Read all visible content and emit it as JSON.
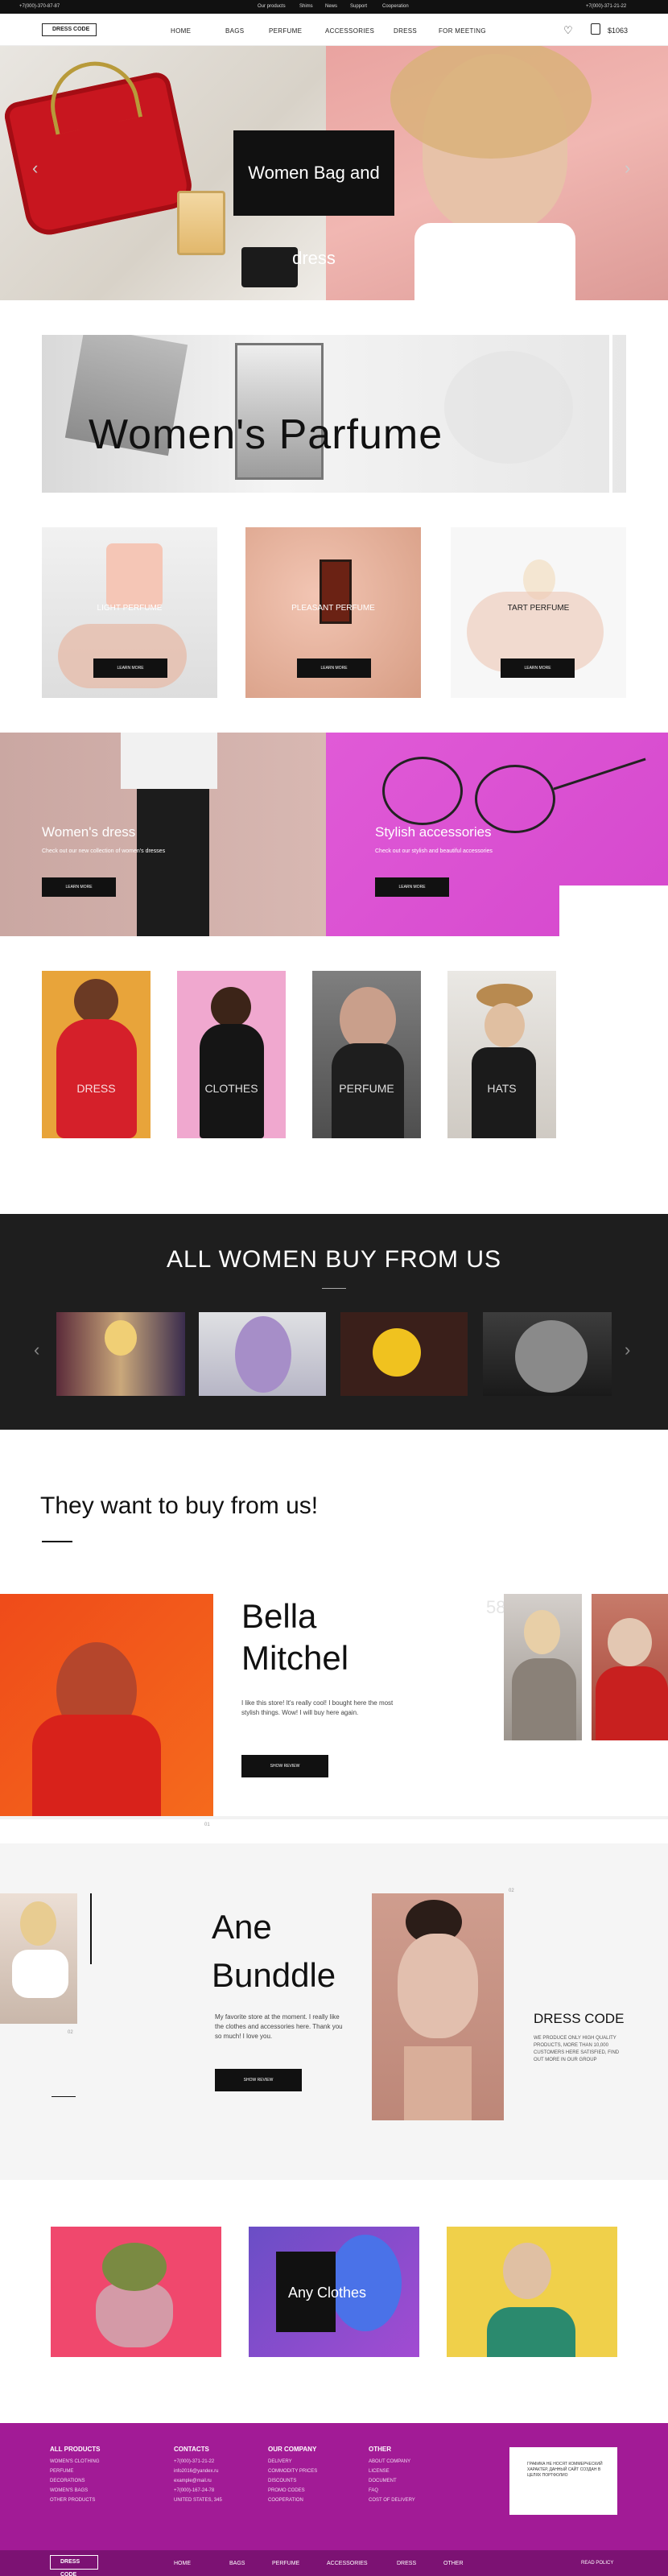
{
  "topbar": {
    "phone_left": "+7(000)-370-87-87",
    "links": [
      "Our products",
      "Shims",
      "News",
      "Support",
      "Cooperation"
    ],
    "phone_right": "+7(000)-371-21-22"
  },
  "header": {
    "logo": "DRESS CODE",
    "nav": [
      "HOME",
      "BAGS",
      "PERFUME",
      "ACCESSORIES",
      "DRESS",
      "FOR MEETING"
    ],
    "cart_total": "$1063"
  },
  "hero": {
    "caption": "Women Bag and dress",
    "prev_icon": "chevron-left-icon",
    "next_icon": "chevron-right-icon"
  },
  "parfume_banner": {
    "title": "Women's Parfume"
  },
  "perfume_cards": [
    {
      "label": "LIGHT PERFUME",
      "button": "LEARN MORE"
    },
    {
      "label": "PLEASANT PERFUME",
      "button": "LEARN MORE"
    },
    {
      "label": "TART PERFUME",
      "button": "LEARN MORE"
    }
  ],
  "promo": [
    {
      "title": "Women's dress",
      "text": "Check out our new collection of women's dresses",
      "button": "LEARN MORE"
    },
    {
      "title": "Stylish accessories",
      "text": "Check out our stylish and beautiful accessories",
      "button": "LEARN MORE"
    }
  ],
  "categories": [
    "DRESS",
    "CLOTHES",
    "PERFUME",
    "HATS"
  ],
  "buy_from_us": {
    "title": "ALL WOMEN BUY FROM US"
  },
  "testimonials": {
    "heading": "They want to buy from us!",
    "first": {
      "name_line1": "Bella",
      "name_line2": "Mitchel",
      "text": "I like this store! It's really cool! I bought here the most stylish things. Wow! I will buy here again.",
      "button": "SHOW REVIEW",
      "page_num": "01",
      "deco_num": "58"
    },
    "second": {
      "name_line1": "Ane",
      "name_line2": "Bunddle",
      "text": "My favorite store at the moment. I really like the clothes and accessories here. Thank you so much! I love you.",
      "button": "SHOW REVIEW",
      "page_num": "02",
      "deco_num": "02"
    },
    "dress_code": {
      "title": "DRESS CODE",
      "text": "WE PRODUCE ONLY HIGH QUALITY PRODUCTS, MORE THAN 10,000 CUSTOMERS HERE SATISFIED, FIND OUT MORE IN OUR GROUP"
    }
  },
  "gallery": {
    "caption": "Any Clothes"
  },
  "footer": {
    "columns": [
      {
        "title": "ALL PRODUCTS",
        "items": [
          "WOMEN'S CLOTHING",
          "PERFUME",
          "DECORATIONS",
          "WOMEN'S BAGS",
          "OTHER PRODUCTS"
        ]
      },
      {
        "title": "CONTACTS",
        "items": [
          "+7(000)-371-21-22",
          "info2016@yandex.ru",
          "example@mail.ru",
          "+7(000)-167-24-78",
          "UNITED STATES, 345"
        ]
      },
      {
        "title": "OUR COMPANY",
        "items": [
          "DELIVERY",
          "COMMODITY PRICES",
          "DISCOUNTS",
          "PROMO CODES",
          "COOPERATION"
        ]
      },
      {
        "title": "OTHER",
        "items": [
          "ABOUT COMPANY",
          "LICENSE",
          "DOCUMENT",
          "FAQ",
          "COST OF DELIVERY"
        ]
      }
    ],
    "note": "ГРАФИКА НЕ НОСЯТ КОММЕРЧЕСКИЙ ХАРАКТЕР, ДАННЫЙ САЙТ СОЗДАН В ЦЕЛЯХ ПОРТФОЛИО",
    "bottom_nav": [
      "HOME",
      "BAGS",
      "PERFUME",
      "ACCESSORIES",
      "DRESS",
      "OTHER"
    ],
    "policy": "READ POLICY",
    "logo": "DRESS CODE"
  }
}
